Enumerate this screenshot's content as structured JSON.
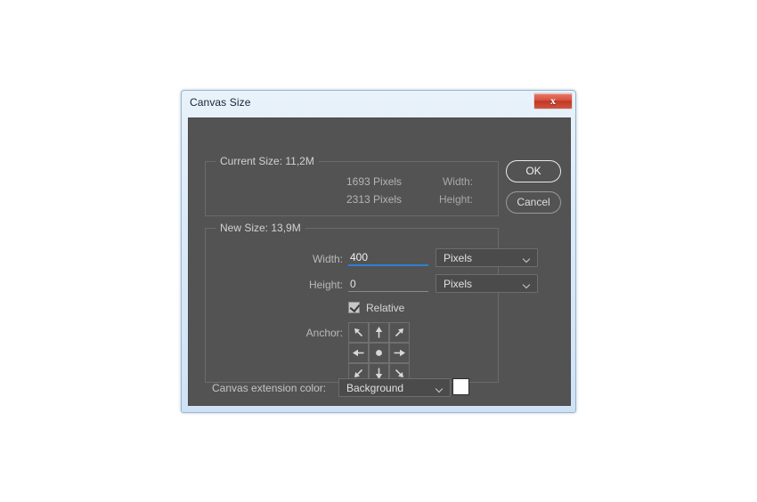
{
  "window": {
    "title": "Canvas Size",
    "close_label": "x"
  },
  "current_size": {
    "legend": "Current Size: 11,2M",
    "rows": [
      {
        "label": "Width:",
        "value": "1693 Pixels"
      },
      {
        "label": "Height:",
        "value": "2313 Pixels"
      }
    ]
  },
  "new_size": {
    "legend": "New Size: 13,9M",
    "width": {
      "label": "Width:",
      "value": "400",
      "unit": "Pixels",
      "focused": true
    },
    "height": {
      "label": "Height:",
      "value": "0",
      "unit": "Pixels",
      "focused": false
    },
    "relative": {
      "label": "Relative",
      "checked": true
    },
    "anchor": {
      "label": "Anchor:",
      "selected": "center",
      "cells": [
        "arrow-up-left",
        "arrow-up",
        "arrow-up-right",
        "arrow-left",
        "center-dot",
        "arrow-right",
        "arrow-down-left",
        "arrow-down",
        "arrow-down-right"
      ]
    }
  },
  "canvas_extension": {
    "label": "Canvas extension color:",
    "value": "Background",
    "swatch_color": "#ffffff"
  },
  "buttons": {
    "ok": "OK",
    "cancel": "Cancel"
  },
  "colors": {
    "panel": "#535353",
    "focus_underline": "#2f7fd4",
    "titlebar": "#dceaf8",
    "close_red": "#d94f3c"
  }
}
